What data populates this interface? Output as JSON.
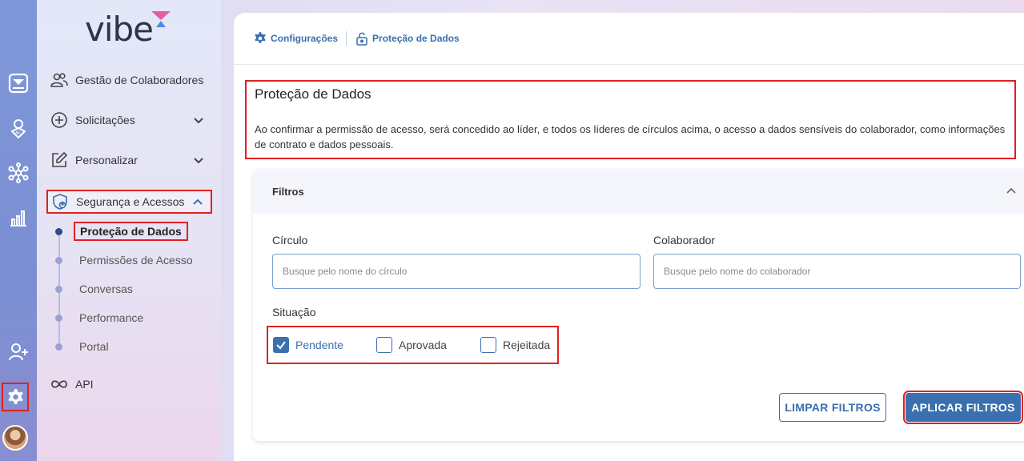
{
  "brand": {
    "logo_text": "vibe",
    "accent": "#3a6fb0",
    "highlight": "#e02020"
  },
  "rail": {
    "icons": [
      "email-icon",
      "ai-location-icon",
      "network-icon",
      "chart-icon",
      "add-user-icon",
      "gear-icon"
    ]
  },
  "sidebar": {
    "items": [
      {
        "label": "Gestão de Colaboradores",
        "icon": "people-icon"
      },
      {
        "label": "Solicitações",
        "icon": "plus-circle-icon"
      },
      {
        "label": "Personalizar",
        "icon": "edit-icon"
      },
      {
        "label": "Segurança e Acessos",
        "icon": "shield-user-icon"
      },
      {
        "label": "API",
        "icon": "infinity-icon"
      }
    ],
    "sub_items": [
      {
        "label": "Proteção de Dados"
      },
      {
        "label": "Permissões de Acesso"
      },
      {
        "label": "Conversas"
      },
      {
        "label": "Performance"
      },
      {
        "label": "Portal"
      }
    ]
  },
  "breadcrumb": {
    "items": [
      {
        "label": "Configurações",
        "icon": "gear-icon"
      },
      {
        "label": "Proteção de Dados",
        "icon": "lock-icon"
      }
    ]
  },
  "page": {
    "title": "Proteção de Dados",
    "description": "Ao confirmar a permissão de acesso, será concedido ao líder, e todos os líderes de círculos acima, o acesso a dados sensíveis do colaborador, como informações de contrato e dados pessoais."
  },
  "filters": {
    "title": "Filtros",
    "circle": {
      "label": "Círculo",
      "placeholder": "Busque pelo nome do círculo",
      "value": ""
    },
    "employee": {
      "label": "Colaborador",
      "placeholder": "Busque pelo nome do colaborador",
      "value": ""
    },
    "status": {
      "label": "Situação",
      "options": [
        {
          "label": "Pendente",
          "checked": true
        },
        {
          "label": "Aprovada",
          "checked": false
        },
        {
          "label": "Rejeitada",
          "checked": false
        }
      ]
    },
    "clear_label": "LIMPAR FILTROS",
    "apply_label": "APLICAR FILTROS"
  }
}
